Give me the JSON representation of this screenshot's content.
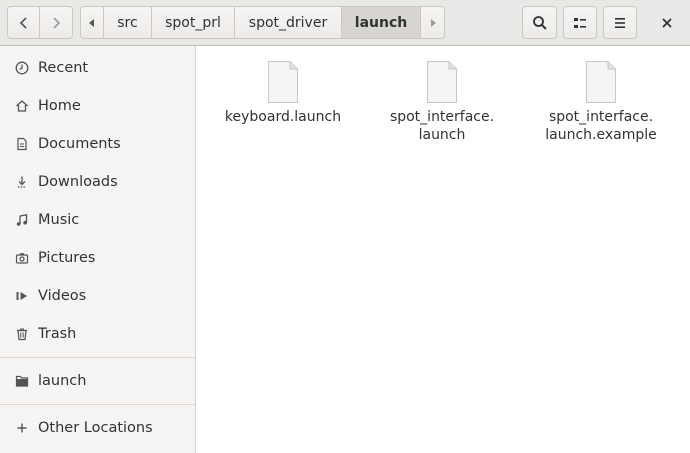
{
  "header": {
    "breadcrumbs": [
      "src",
      "spot_prl",
      "spot_driver",
      "launch"
    ],
    "active_crumb": "launch"
  },
  "sidebar": {
    "items": [
      {
        "label": "Recent",
        "icon": "clock-icon"
      },
      {
        "label": "Home",
        "icon": "home-icon"
      },
      {
        "label": "Documents",
        "icon": "document-icon"
      },
      {
        "label": "Downloads",
        "icon": "download-icon"
      },
      {
        "label": "Music",
        "icon": "music-icon"
      },
      {
        "label": "Pictures",
        "icon": "camera-icon"
      },
      {
        "label": "Videos",
        "icon": "video-icon"
      },
      {
        "label": "Trash",
        "icon": "trash-icon"
      }
    ],
    "bookmarks": [
      {
        "label": "launch",
        "icon": "folder-icon"
      }
    ],
    "other_locations": {
      "label": "Other Locations",
      "icon": "plus-icon"
    }
  },
  "files": [
    {
      "line1": "keyboard.launch",
      "line2": ""
    },
    {
      "line1": "spot_interface.",
      "line2": "launch"
    },
    {
      "line1": "spot_interface.",
      "line2": "launch.example"
    }
  ]
}
